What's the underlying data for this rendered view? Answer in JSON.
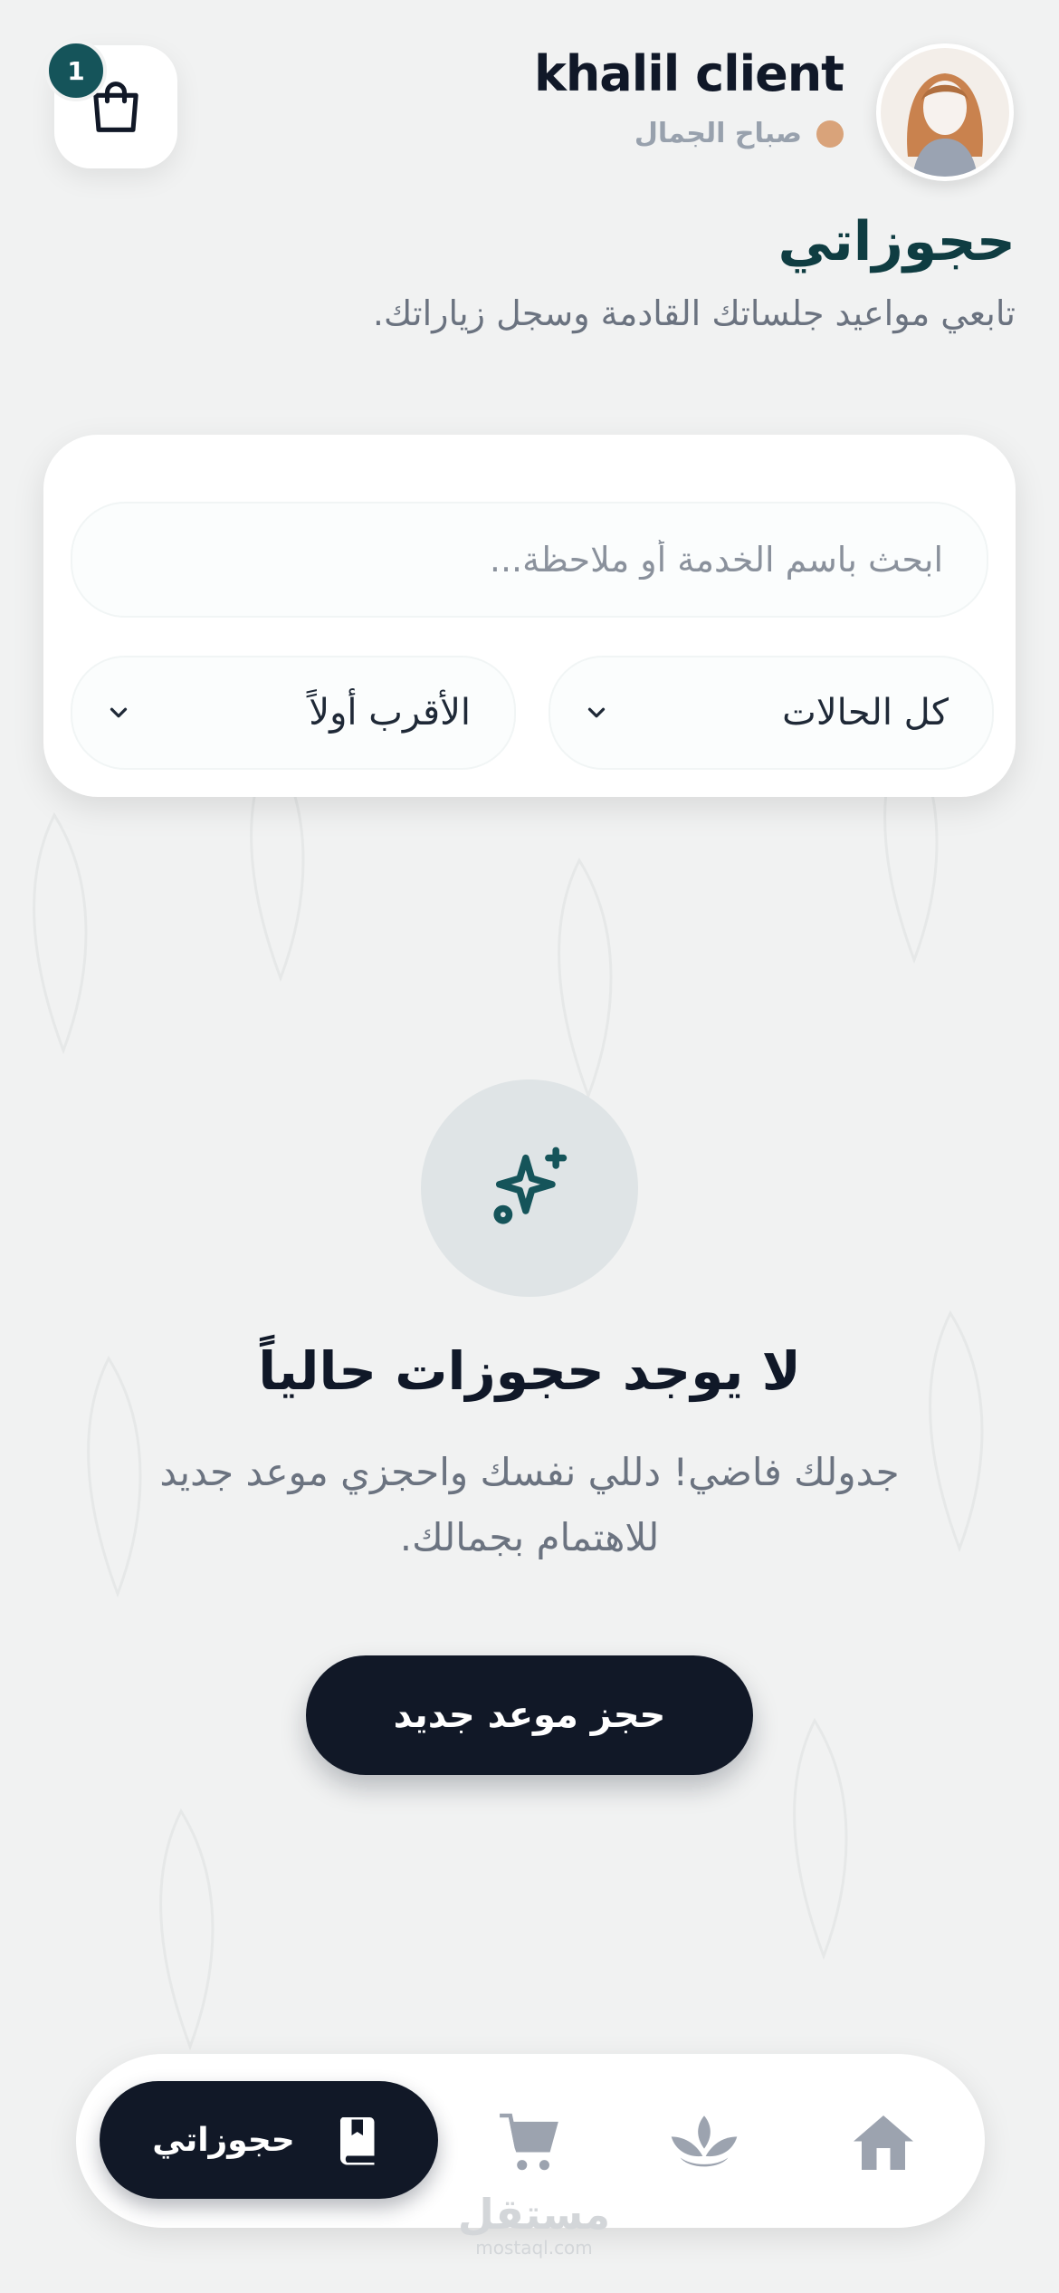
{
  "header": {
    "username": "khalil client",
    "greeting": "صباح الجمال",
    "cart_count": "1",
    "avatar_icon": "user-avatar"
  },
  "page": {
    "title": "حجوزاتي",
    "subtitle": "تابعي مواعيد جلساتك القادمة وسجل زياراتك."
  },
  "filters": {
    "search_placeholder": "ابحث باسم الخدمة أو ملاحظة...",
    "status_value": "كل الحالات",
    "sort_value": "الأقرب أولاً"
  },
  "empty_state": {
    "icon": "sparkles-icon",
    "title": "لا يوجد حجوزات حالياً",
    "text": "جدولك فاضي! دللي نفسك واحجزي موعد جديد للاهتمام بجمالك.",
    "button_label": "حجز موعد جديد"
  },
  "bottom_nav": {
    "active_label": "حجوزاتي",
    "items": [
      "home-icon",
      "lotus-icon",
      "cart-icon",
      "bookings-icon"
    ]
  },
  "watermark": {
    "text": "مستقل",
    "sub": "mostaql.com"
  },
  "colors": {
    "background": "#f1f2f2",
    "primary_dark": "#111827",
    "teal": "#15545a",
    "title_teal": "#0f3d42",
    "accent_dot": "#d9a37a"
  }
}
